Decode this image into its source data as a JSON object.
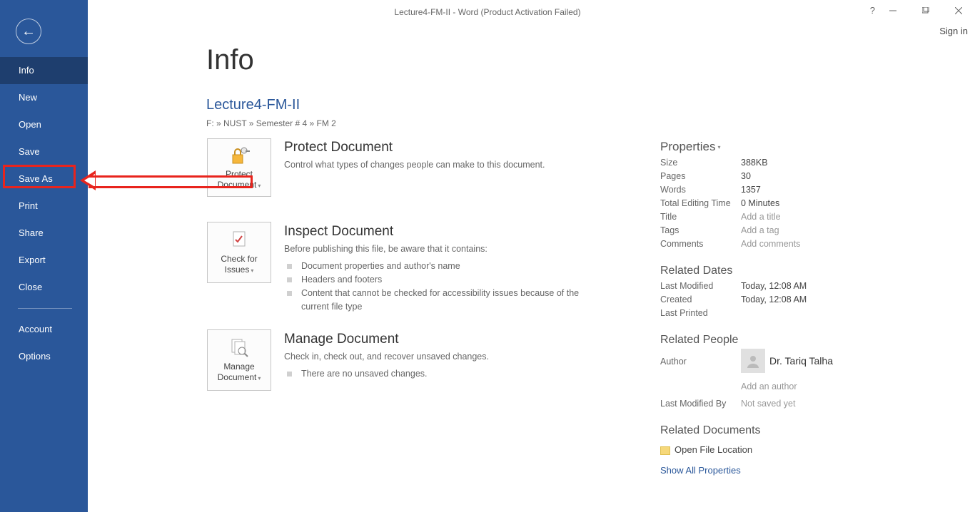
{
  "window": {
    "title": "Lecture4-FM-II - Word (Product Activation Failed)",
    "signin": "Sign in"
  },
  "sidebar": {
    "items": [
      "Info",
      "New",
      "Open",
      "Save",
      "Save As",
      "Print",
      "Share",
      "Export",
      "Close"
    ],
    "lower": [
      "Account",
      "Options"
    ]
  },
  "page": {
    "heading": "Info",
    "docname": "Lecture4-FM-II",
    "docpath": "F: » NUST » Semester # 4 » FM 2"
  },
  "protect": {
    "btn": "Protect Document",
    "title": "Protect Document",
    "sub": "Control what types of changes people can make to this document."
  },
  "inspect": {
    "btn": "Check for Issues",
    "title": "Inspect Document",
    "sub": "Before publishing this file, be aware that it contains:",
    "items": [
      "Document properties and author's name",
      "Headers and footers",
      "Content that cannot be checked for accessibility issues because of the current file type"
    ]
  },
  "manage": {
    "btn": "Manage Document",
    "title": "Manage Document",
    "sub": "Check in, check out, and recover unsaved changes.",
    "status": "There are no unsaved changes."
  },
  "props": {
    "hdr": "Properties",
    "rows": {
      "size_k": "Size",
      "size_v": "388KB",
      "pages_k": "Pages",
      "pages_v": "30",
      "words_k": "Words",
      "words_v": "1357",
      "edit_k": "Total Editing Time",
      "edit_v": "0 Minutes",
      "title_k": "Title",
      "title_v": "Add a title",
      "tags_k": "Tags",
      "tags_v": "Add a tag",
      "comments_k": "Comments",
      "comments_v": "Add comments"
    },
    "dates_hdr": "Related Dates",
    "dates": {
      "mod_k": "Last Modified",
      "mod_v": "Today, 12:08 AM",
      "cr_k": "Created",
      "cr_v": "Today, 12:08 AM",
      "pr_k": "Last Printed",
      "pr_v": ""
    },
    "people_hdr": "Related People",
    "author_k": "Author",
    "author_v": "Dr. Tariq Talha",
    "add_author": "Add an author",
    "modby_k": "Last Modified By",
    "modby_v": "Not saved yet",
    "docs_hdr": "Related Documents",
    "openloc": "Open File Location",
    "showall": "Show All Properties"
  }
}
